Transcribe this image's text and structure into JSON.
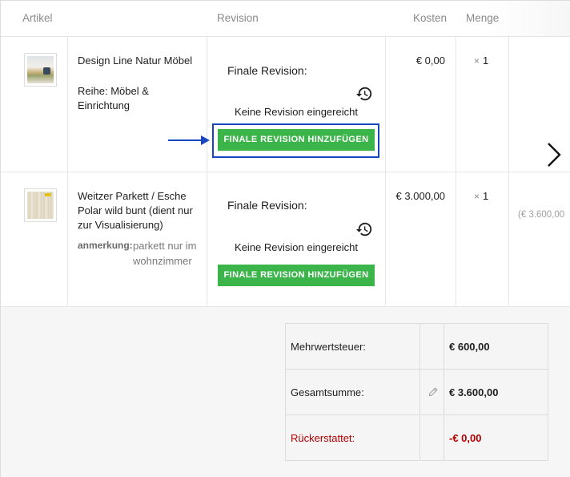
{
  "table": {
    "headers": {
      "article": "Artikel",
      "revision": "Revision",
      "cost": "Kosten",
      "quantity": "Menge"
    }
  },
  "items": [
    {
      "image_icon": "furniture-thumbnail",
      "name": "Design Line Natur Möbel",
      "series": "Reihe: Möbel & Einrichtung",
      "revision_label": "Finale Revision:",
      "revision_status": "Keine Revision eingereicht",
      "button_label": "FINALE REVISION HINZUFÜGEN",
      "cost": "€ 0,00",
      "quantity_prefix": "×",
      "quantity": "1"
    },
    {
      "image_icon": "parquet-thumbnail",
      "name": "Weitzer Parkett / Esche Polar wild bunt (dient nur zur Visualisierung)",
      "note_label": "anmerkung:",
      "note_value": "parkett nur im wohnzimmer",
      "revision_label": "Finale Revision:",
      "revision_status": "Keine Revision eingereicht",
      "button_label": "FINALE REVISION HINZUFÜGEN",
      "cost": "€ 3.000,00",
      "quantity_prefix": "×",
      "quantity": "1",
      "line_total": "(€ 3.600,00"
    }
  ],
  "totals": {
    "vat_label": "Mehrwertsteuer:",
    "vat_value": "€ 600,00",
    "grand_label": "Gesamtsumme:",
    "grand_value": "€ 3.600,00",
    "refund_label": "Rückerstattet:",
    "refund_value": "-€ 0,00"
  },
  "colors": {
    "button_green": "#3bb54a",
    "highlight_blue": "#1746c2",
    "refund_red": "#b00000"
  },
  "icons": [
    "history-icon",
    "pencil-icon",
    "chevron-right-icon",
    "arrow-right-icon"
  ]
}
